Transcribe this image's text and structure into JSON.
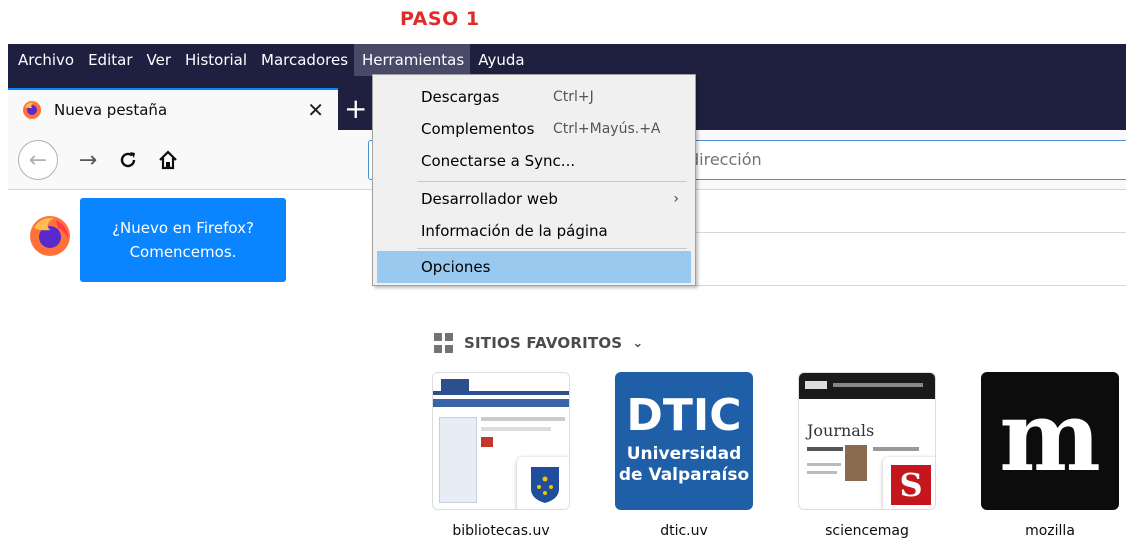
{
  "annotation": {
    "step": "PASO 1"
  },
  "menubar": {
    "items": [
      "Archivo",
      "Editar",
      "Ver",
      "Historial",
      "Marcadores",
      "Herramientas",
      "Ayuda"
    ]
  },
  "tab": {
    "title": "Nueva pestaña",
    "close": "✕",
    "new_tab": "+"
  },
  "navbar": {
    "url_placeholder": "dirección"
  },
  "tip": {
    "line1": "¿Nuevo en Firefox?",
    "line2": "Comencemos."
  },
  "dropdown": {
    "items": [
      {
        "label": "Descargas",
        "shortcut": "Ctrl+J"
      },
      {
        "label": "Complementos",
        "shortcut": "Ctrl+Mayús.+A"
      },
      {
        "label": "Conectarse a Sync..."
      },
      {
        "label": "Desarrollador web",
        "submenu": "›"
      },
      {
        "label": "Información de la página"
      },
      {
        "label": "Opciones"
      }
    ]
  },
  "favorites": {
    "header": "SITIOS FAVORITOS",
    "tiles": [
      {
        "label": "bibliotecas.uv"
      },
      {
        "label": "dtic.uv",
        "line1": "DTIC",
        "line2": "Universidad",
        "line3": "de Valparaíso"
      },
      {
        "label": "sciencemag",
        "heading": "Journals"
      },
      {
        "label": "mozilla",
        "logo": "m"
      }
    ]
  },
  "colors": {
    "menubar_bg": "#1f1f40",
    "tip_bg": "#0a84ff",
    "menu_highlight": "#99c9ef",
    "step_red": "#e22a2a"
  }
}
